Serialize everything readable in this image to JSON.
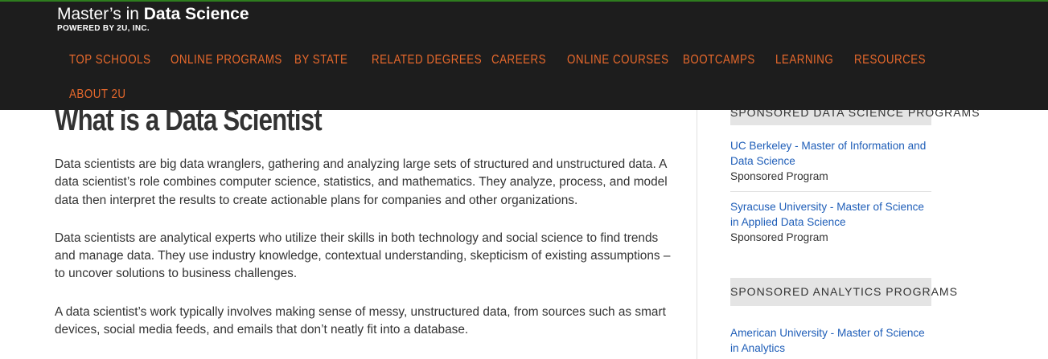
{
  "header": {
    "brand_prefix": "Master’s in ",
    "brand_strong": "Data Science",
    "brand_sub": "POWERED BY 2U, INC.",
    "accent_color": "#e8692c",
    "nav": [
      "TOP SCHOOLS",
      "ONLINE PROGRAMS",
      "BY STATE",
      "RELATED DEGREES",
      "CAREERS",
      "ONLINE COURSES",
      "BOOTCAMPS",
      "LEARNING",
      "RESOURCES",
      "ABOUT 2U"
    ]
  },
  "main": {
    "title": "What is a Data Scientist",
    "paragraphs": [
      "Data scientists are big data wranglers, gathering and analyzing large sets of structured and unstructured data. A data scientist’s role combines computer science, statistics, and mathematics. They analyze, process, and model data then interpret the results to create actionable plans for companies and other organizations.",
      "Data scientists are analytical experts who utilize their skills in both technology and social science to find trends and manage data. They use industry knowledge, contextual understanding, skepticism of existing assumptions – to uncover solutions to business challenges.",
      "A data scientist’s work typically involves making sense of messy, unstructured data, from sources such as smart devices, social media feeds, and emails that don’t neatly fit into a database."
    ]
  },
  "sidebar": {
    "heading_1": "SPONSORED DATA SCIENCE PROGRAMS",
    "programs_1": [
      {
        "title": "UC Berkeley - Master of Information and Data Science",
        "sub": "Sponsored Program"
      },
      {
        "title": "Syracuse University - Master of Science in Applied Data Science",
        "sub": "Sponsored Program"
      }
    ],
    "heading_2": "SPONSORED ANALYTICS PROGRAMS",
    "programs_2": [
      {
        "title": "American University - Master of Science in Analytics"
      }
    ]
  }
}
